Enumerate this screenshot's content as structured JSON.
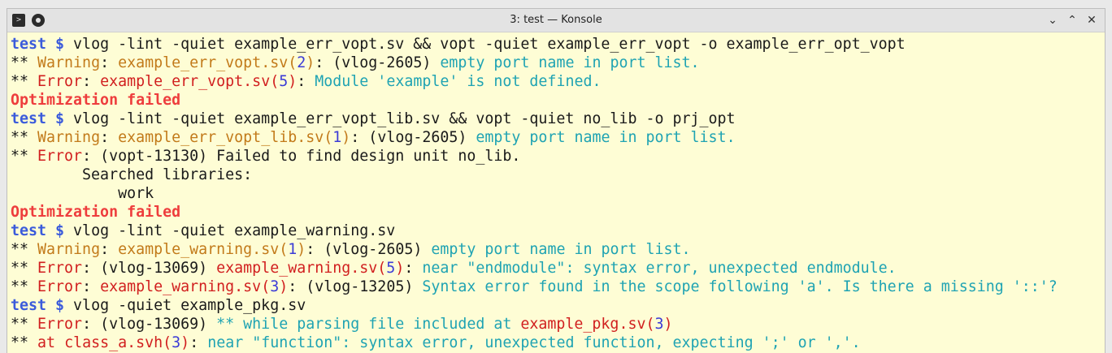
{
  "window": {
    "title": "3: test — Konsole",
    "controls": {
      "minimize": "⌄",
      "maximize": "⌃",
      "close": "✕"
    },
    "icons": [
      "terminal-app-icon",
      "pin-icon"
    ]
  },
  "colors": {
    "background": "#fefdd5",
    "prompt": "#3b5bdb",
    "warning": "#c27a1a",
    "error": "#d11f1f",
    "info": "#1fa3b3",
    "failed": "#ee3d3d"
  },
  "lines": [
    {
      "prompt": "test $",
      "cmd": " vlog -lint -quiet example_err_vopt.sv && vopt -quiet example_err_vopt -o example_err_opt_vopt"
    },
    {
      "stars": "** ",
      "label": "Warning",
      "colon": ": ",
      "file": "example_err_vopt.sv",
      "lp": "(",
      "line": "2",
      "rp": ")",
      "code": ": (vlog-2605) ",
      "msg": "empty port name in port list."
    },
    {
      "stars": "** ",
      "label": "Error",
      "colon": ": ",
      "file": "example_err_vopt.sv",
      "lp": "(",
      "line": "5",
      "rp": ")",
      "code": ": ",
      "msg": "Module 'example' is not defined."
    },
    {
      "failed": "Optimization failed"
    },
    {
      "prompt": "test $",
      "cmd": " vlog -lint -quiet example_err_vopt_lib.sv && vopt -quiet no_lib -o prj_opt"
    },
    {
      "stars": "** ",
      "label": "Warning",
      "colon": ": ",
      "file": "example_err_vopt_lib.sv",
      "lp": "(",
      "line": "1",
      "rp": ")",
      "code": ": (vlog-2605) ",
      "msg": "empty port name in port list."
    },
    {
      "stars": "** ",
      "label": "Error",
      "rest": ": (vopt-13130) Failed to find design unit no_lib."
    },
    {
      "plain": "        Searched libraries:"
    },
    {
      "plain": "            work"
    },
    {
      "failed": "Optimization failed"
    },
    {
      "prompt": "test $",
      "cmd": " vlog -lint -quiet example_warning.sv"
    },
    {
      "stars": "** ",
      "label": "Warning",
      "colon": ": ",
      "file": "example_warning.sv",
      "lp": "(",
      "line": "1",
      "rp": ")",
      "code": ": (vlog-2605) ",
      "msg": "empty port name in port list."
    },
    {
      "stars": "** ",
      "label": "Error",
      "pre": ": (vlog-13069) ",
      "file": "example_warning.sv",
      "lp": "(",
      "line": "5",
      "rp": ")",
      "code": ": ",
      "msg": "near \"endmodule\": syntax error, unexpected endmodule."
    },
    {
      "stars": "** ",
      "label": "Error",
      "colon": ": ",
      "file": "example_warning.sv",
      "lp": "(",
      "line": "3",
      "rp": ")",
      "code": ": (vlog-13205) ",
      "msg": "Syntax error found in the scope following 'a'. Is there a missing '::'?"
    },
    {
      "prompt": "test $",
      "cmd": " vlog -quiet example_pkg.sv"
    },
    {
      "stars": "** ",
      "label": "Error",
      "pre": ": (vlog-13069) ",
      "msg2": "** while parsing file included at ",
      "file": "example_pkg.sv",
      "lp": "(",
      "line": "3",
      "rp": ")"
    },
    {
      "stars": "** ",
      "label": "at",
      "space": " ",
      "file": "class_a.svh",
      "lp": "(",
      "line": "3",
      "rp": ")",
      "code": ": ",
      "msg": "near \"function\": syntax error, unexpected function, expecting ';' or ','."
    }
  ]
}
